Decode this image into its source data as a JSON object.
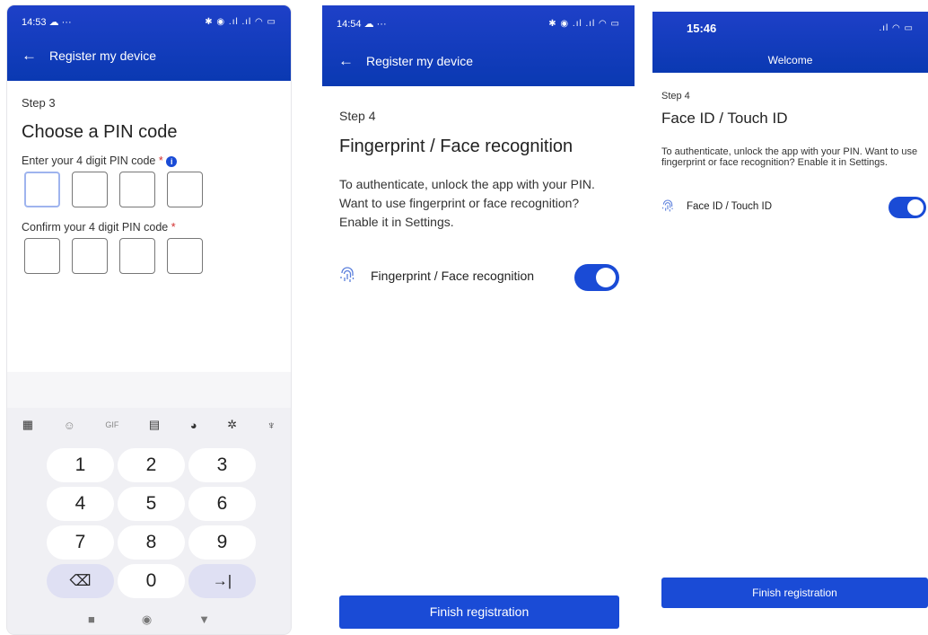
{
  "screen1": {
    "status_time": "14:53 ☁ ···",
    "status_right": "✱ ◉ .ıl .ıl ◠ ▭",
    "appbar_title": "Register my device",
    "step": "Step 3",
    "title": "Choose a PIN code",
    "enter_label": "Enter your 4 digit PIN code",
    "confirm_label": "Confirm your 4 digit PIN code",
    "required_mark": "*",
    "info_glyph": "i",
    "keyboard": {
      "toolbar": [
        {
          "icon": "apps-grid-icon",
          "glyph": "▦"
        },
        {
          "icon": "sticker-icon",
          "glyph": "☺"
        },
        {
          "icon": "gif-icon",
          "glyph": "GIF"
        },
        {
          "icon": "clipboard-icon",
          "glyph": "▤"
        },
        {
          "icon": "palette-icon",
          "glyph": "◕"
        },
        {
          "icon": "settings-gear-icon",
          "glyph": "✲"
        },
        {
          "icon": "microphone-icon",
          "glyph": "♆"
        }
      ],
      "keys": [
        "1",
        "2",
        "3",
        "4",
        "5",
        "6",
        "7",
        "8",
        "9",
        "⌫",
        "0",
        "→|"
      ],
      "nav": [
        "■",
        "◉",
        "▼"
      ]
    }
  },
  "screen2": {
    "status_time": "14:54 ☁ ···",
    "status_right": "✱ ◉ .ıl .ıl ◠ ▭",
    "appbar_title": "Register my device",
    "step": "Step 4",
    "title": "Fingerprint / Face recognition",
    "description": "To authenticate, unlock the app with your PIN. Want to use fingerprint or face recognition? Enable it in Settings.",
    "toggle_label": "Fingerprint / Face recognition",
    "toggle_on": true,
    "finish_label": "Finish registration"
  },
  "screen3": {
    "status_time": "15:46",
    "status_right": ".ıl ◠ ▭",
    "header_title": "Welcome",
    "step": "Step 4",
    "title": "Face ID / Touch ID",
    "description": "To authenticate, unlock the app with your PIN. Want to use fingerprint or face recognition? Enable it in Settings.",
    "toggle_label": "Face ID / Touch ID",
    "toggle_on": true,
    "finish_label": "Finish registration"
  },
  "colors": {
    "header_blue": "#0a39b2",
    "accent_blue": "#1a4bd6",
    "required_red": "#d32f2f"
  }
}
